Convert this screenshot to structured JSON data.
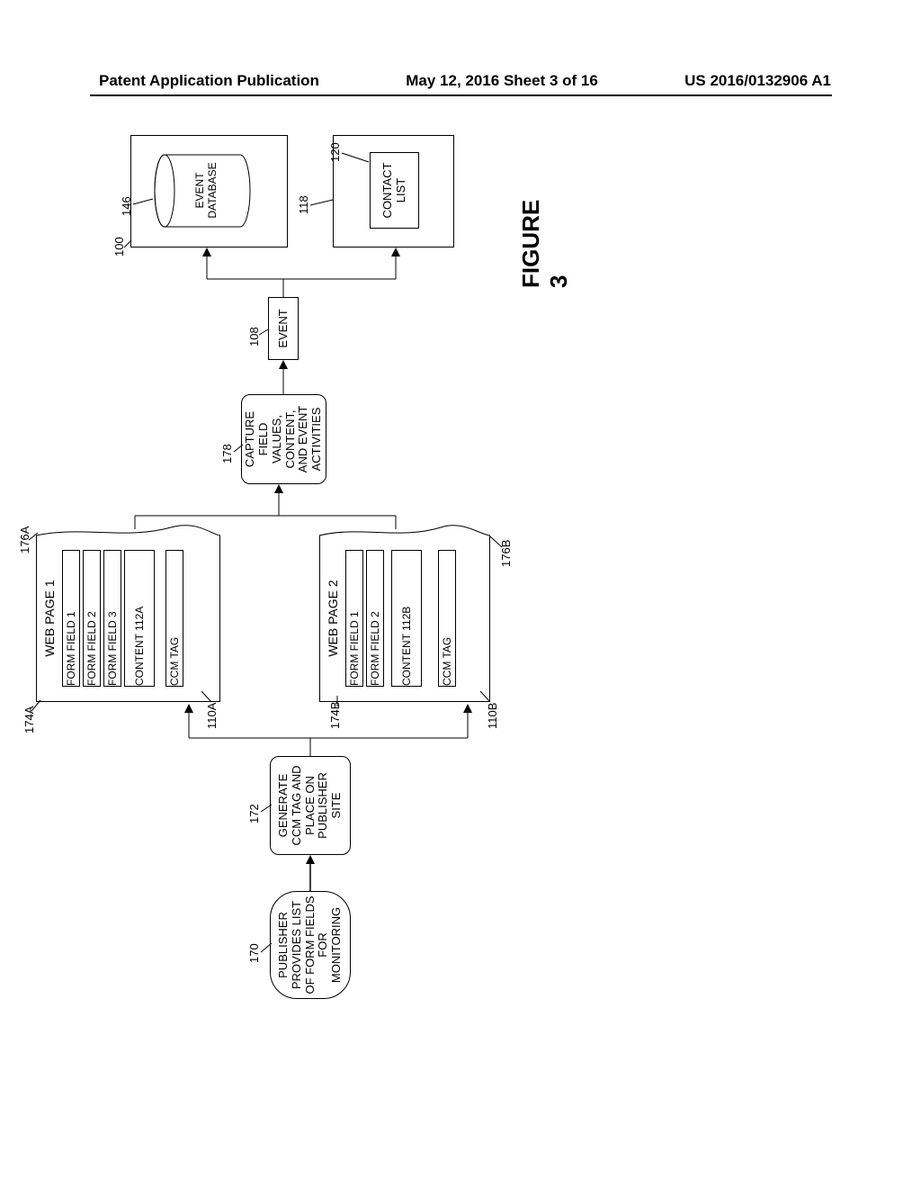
{
  "header": {
    "left": "Patent Application Publication",
    "middle": "May 12, 2016  Sheet 3 of 16",
    "right": "US 2016/0132906 A1"
  },
  "figure_label": "FIGURE 3",
  "blocks": {
    "b170": {
      "text": "PUBLISHER PROVIDES LIST OF FORM FIELDS FOR MONITORING",
      "ref": "170"
    },
    "b172": {
      "text": "GENERATE CCM TAG AND PLACE ON PUBLISHER SITE",
      "ref": "172"
    },
    "b178": {
      "text": "CAPTURE FIELD VALUES, CONTENT, AND EVENT ACTIVITIES",
      "ref": "178"
    },
    "b108": {
      "text": "EVENT",
      "ref": "108"
    }
  },
  "page1": {
    "ref": "176A",
    "tag_ref": "174A",
    "ccm_ref": "110A",
    "title": "WEB PAGE 1",
    "fields": [
      "FORM FIELD 1",
      "FORM FIELD 2",
      "FORM FIELD 3"
    ],
    "content": "CONTENT 112A",
    "ccm": "CCM TAG"
  },
  "page2": {
    "ref": "176B",
    "tag_ref": "174B",
    "ccm_ref": "110B",
    "title": "WEB PAGE 2",
    "fields": [
      "FORM FIELD 1",
      "FORM FIELD 2"
    ],
    "content": "CONTENT 112B",
    "ccm": "CCM TAG"
  },
  "right": {
    "container100_ref": "100",
    "db_label": "EVENT DATABASE",
    "db_ref": "146",
    "container118_ref": "118",
    "contact_label": "CONTACT LIST",
    "contact_ref": "120"
  }
}
